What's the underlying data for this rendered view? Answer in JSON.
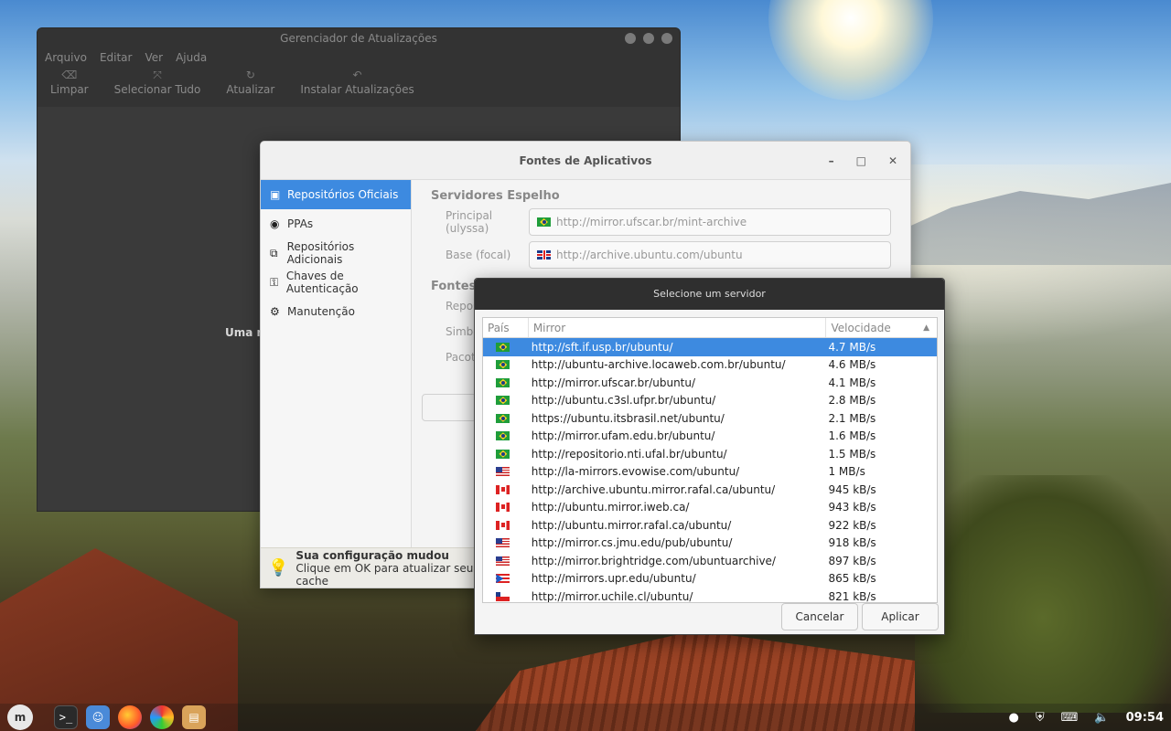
{
  "update_manager": {
    "title": "Gerenciador de Atualizações",
    "menu": [
      "Arquivo",
      "Editar",
      "Ver",
      "Ajuda"
    ],
    "toolbar": [
      {
        "label": "Limpar",
        "icon": "clear-icon"
      },
      {
        "label": "Selecionar Tudo",
        "icon": "select-all-icon"
      },
      {
        "label": "Atualizar",
        "icon": "refresh-icon"
      },
      {
        "label": "Instalar Atualizações",
        "icon": "install-icon"
      }
    ],
    "body_text": "Uma no"
  },
  "sources": {
    "title": "Fontes de Aplicativos",
    "sidebar": [
      {
        "label": "Repositórios Oficiais",
        "icon": "official-repos-icon",
        "active": true
      },
      {
        "label": "PPAs",
        "icon": "ppa-icon"
      },
      {
        "label": "Repositórios Adicionais",
        "icon": "additional-repos-icon"
      },
      {
        "label": "Chaves de Autenticação",
        "icon": "key-icon"
      },
      {
        "label": "Manutenção",
        "icon": "maintenance-icon"
      }
    ],
    "mirrors_title": "Servidores Espelho",
    "main_label": "Principal (ulyssa)",
    "main_value": "http://mirror.ufscar.br/mint-archive",
    "base_label": "Base (focal)",
    "base_value": "http://archive.ubuntu.com/ubuntu",
    "optional_title": "Fontes O",
    "optional_rows": [
      "Reposit",
      "Simbolo",
      "Pacotes"
    ],
    "notice_title": "Sua configuração mudou",
    "notice_text": "Clique em OK para atualizar seu cache"
  },
  "server_dialog": {
    "title": "Selecione um servidor",
    "columns": {
      "country": "País",
      "mirror": "Mirror",
      "speed": "Velocidade"
    },
    "rows": [
      {
        "flag": "br",
        "mirror": "http://sft.if.usp.br/ubuntu/",
        "speed": "4.7 MB/s",
        "selected": true
      },
      {
        "flag": "br",
        "mirror": "http://ubuntu-archive.locaweb.com.br/ubuntu/",
        "speed": "4.6 MB/s"
      },
      {
        "flag": "br",
        "mirror": "http://mirror.ufscar.br/ubuntu/",
        "speed": "4.1 MB/s"
      },
      {
        "flag": "br",
        "mirror": "http://ubuntu.c3sl.ufpr.br/ubuntu/",
        "speed": "2.8 MB/s"
      },
      {
        "flag": "br",
        "mirror": "https://ubuntu.itsbrasil.net/ubuntu/",
        "speed": "2.1 MB/s"
      },
      {
        "flag": "br",
        "mirror": "http://mirror.ufam.edu.br/ubuntu/",
        "speed": "1.6 MB/s"
      },
      {
        "flag": "br",
        "mirror": "http://repositorio.nti.ufal.br/ubuntu/",
        "speed": "1.5 MB/s"
      },
      {
        "flag": "us",
        "mirror": "http://la-mirrors.evowise.com/ubuntu/",
        "speed": "1 MB/s"
      },
      {
        "flag": "ca",
        "mirror": "http://archive.ubuntu.mirror.rafal.ca/ubuntu/",
        "speed": "945 kB/s"
      },
      {
        "flag": "ca",
        "mirror": "http://ubuntu.mirror.iweb.ca/",
        "speed": "943 kB/s"
      },
      {
        "flag": "ca",
        "mirror": "http://ubuntu.mirror.rafal.ca/ubuntu/",
        "speed": "922 kB/s"
      },
      {
        "flag": "us",
        "mirror": "http://mirror.cs.jmu.edu/pub/ubuntu/",
        "speed": "918 kB/s"
      },
      {
        "flag": "us",
        "mirror": "http://mirror.brightridge.com/ubuntuarchive/",
        "speed": "897 kB/s"
      },
      {
        "flag": "pr",
        "mirror": "http://mirrors.upr.edu/ubuntu/",
        "speed": "865 kB/s"
      },
      {
        "flag": "cl",
        "mirror": "http://mirror.uchile.cl/ubuntu/",
        "speed": "821 kB/s"
      }
    ],
    "cancel_label": "Cancelar",
    "apply_label": "Aplicar"
  },
  "taskbar": {
    "clock": "09:54",
    "apps": [
      "mint-menu-icon",
      "terminal-icon",
      "files-icon",
      "firefox-icon",
      "photos-icon",
      "package-icon"
    ]
  },
  "colors": {
    "accent": "#3d8ae0",
    "dialog_title": "#2f2f2f"
  }
}
